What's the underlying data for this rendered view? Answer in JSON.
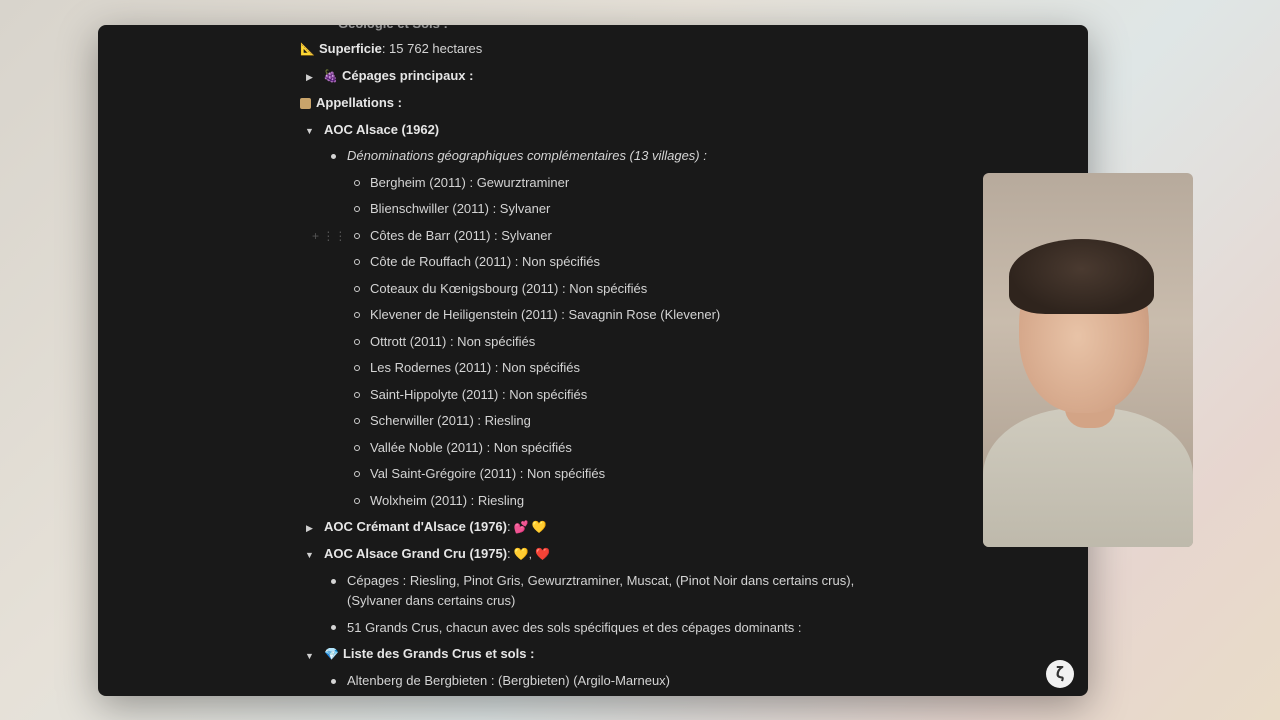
{
  "header_cut": "Géologie et Sols :",
  "superficie": {
    "label": "Superficie",
    "value": " : 15 762 hectares"
  },
  "cepages_principaux": "Cépages principaux :",
  "appellations": "Appellations :",
  "aoc_alsace": "AOC Alsace (1962)",
  "denominations": "Dénominations géographiques complémentaires (13 villages) :",
  "villages": [
    "Bergheim (2011) : Gewurztraminer",
    "Blienschwiller (2011) : Sylvaner",
    "Côtes de Barr (2011) : Sylvaner",
    "Côte de Rouffach (2011) : Non spécifiés",
    "Coteaux du Kœnigsbourg (2011) : Non spécifiés",
    "Klevener de Heiligenstein (2011) : Savagnin Rose (Klevener)",
    "Ottrott (2011) : Non spécifiés",
    "Les Rodernes (2011) : Non spécifiés",
    "Saint-Hippolyte (2011) : Non spécifiés",
    "Scherwiller (2011) : Riesling",
    "Vallée Noble (2011) : Non spécifiés",
    "Val Saint-Grégoire (2011) : Non spécifiés",
    "Wolxheim (2011) : Riesling"
  ],
  "cremant": {
    "label": "AOC Crémant d'Alsace (1976)",
    "suffix": " : ",
    "emoji": "💕 💛"
  },
  "grand_cru": {
    "label": "AOC Alsace Grand Cru (1975)",
    "suffix": " : ",
    "emoji": "💛, ❤️"
  },
  "grand_cru_cepages_1": "Cépages : Riesling, Pinot Gris, Gewurztraminer, Muscat, (Pinot Noir dans certains crus),",
  "grand_cru_cepages_2": "(Sylvaner dans certains crus)",
  "grands_crus_count": "51 Grands Crus, chacun avec des sols spécifiques et des cépages dominants :",
  "liste_grands_crus": "Liste des Grands Crus et sols :",
  "altenberg": "Altenberg de Bergbieten : (Bergbieten) (Argilo-Marneux)",
  "icons": {
    "ruler": "📐",
    "grapes": "🍇",
    "label": "🏷",
    "diamond": "💎",
    "assistant": "𝛇"
  },
  "colors": {
    "bg": "#191919",
    "text": "#d4d4d4"
  }
}
